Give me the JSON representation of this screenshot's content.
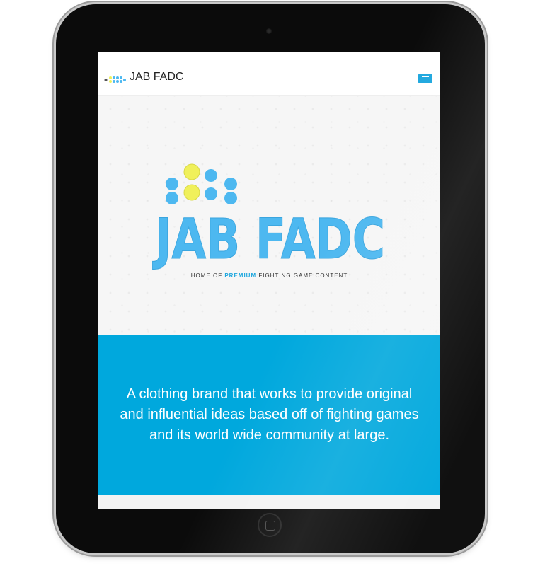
{
  "navbar": {
    "brand": "JAB FADC",
    "logo_icon": "jab-fadc-buttons-logo",
    "menu_icon": "hamburger-menu-icon"
  },
  "hero": {
    "logo_text": "JAB FADC",
    "tagline_before": "HOME OF ",
    "tagline_accent": "PREMIUM",
    "tagline_after": " FIGHTING GAME CONTENT"
  },
  "about": {
    "text": "A clothing brand that works to provide original and influential ideas based off of fighting games and its world wide community at large."
  },
  "colors": {
    "brand_blue": "#00a8dd",
    "logo_blue": "#4db8f0",
    "accent_yellow": "#f0f05a"
  }
}
